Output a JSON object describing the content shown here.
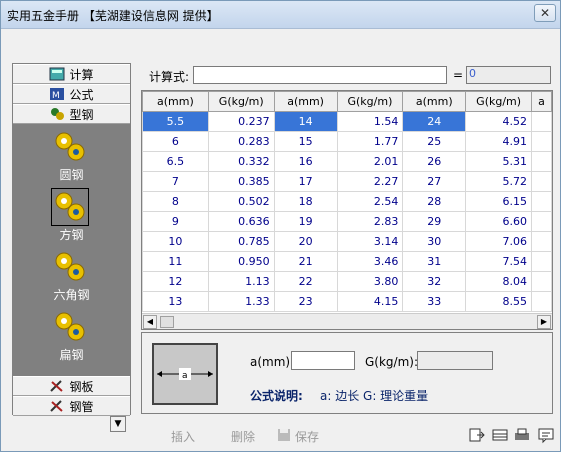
{
  "window": {
    "title": "实用五金手册 【芜湖建设信息网 提供】",
    "close_label": "✕"
  },
  "nav": {
    "categories": [
      {
        "label": "计算",
        "icon": "calculator-icon"
      },
      {
        "label": "公式",
        "icon": "formula-icon"
      },
      {
        "label": "型钢",
        "icon": "gears-icon"
      },
      {
        "label": "钢板",
        "icon": "tools-icon"
      },
      {
        "label": "钢管",
        "icon": "tools-icon"
      }
    ],
    "shapes": [
      {
        "label": "圆钢"
      },
      {
        "label": "方钢"
      },
      {
        "label": "六角钢"
      },
      {
        "label": "扁钢"
      }
    ]
  },
  "formula": {
    "label": "计算式:",
    "value": "",
    "equals": "=",
    "result": "0"
  },
  "table": {
    "headers": [
      "a(mm)",
      "G(kg/m)",
      "a(mm)",
      "G(kg/m)",
      "a(mm)",
      "G(kg/m)",
      "a"
    ],
    "rows": [
      [
        "5.5",
        "0.237",
        "14",
        "1.54",
        "24",
        "4.52"
      ],
      [
        "6",
        "0.283",
        "15",
        "1.77",
        "25",
        "4.91"
      ],
      [
        "6.5",
        "0.332",
        "16",
        "2.01",
        "26",
        "5.31"
      ],
      [
        "7",
        "0.385",
        "17",
        "2.27",
        "27",
        "5.72"
      ],
      [
        "8",
        "0.502",
        "18",
        "2.54",
        "28",
        "6.15"
      ],
      [
        "9",
        "0.636",
        "19",
        "2.83",
        "29",
        "6.60"
      ],
      [
        "10",
        "0.785",
        "20",
        "3.14",
        "30",
        "7.06"
      ],
      [
        "11",
        "0.950",
        "21",
        "3.46",
        "31",
        "7.54"
      ],
      [
        "12",
        "1.13",
        "22",
        "3.80",
        "32",
        "8.04"
      ],
      [
        "13",
        "1.33",
        "23",
        "4.15",
        "33",
        "8.55"
      ]
    ]
  },
  "bottom": {
    "diagram_label": "a",
    "a_label": "a(mm):",
    "a_value": "",
    "g_label": "G(kg/m):",
    "g_value": "",
    "note_title": "公式说明:",
    "note_text": "a: 边长   G: 理论重量"
  },
  "toolbar": {
    "insert": "插入",
    "delete": "删除",
    "save": "保存"
  },
  "colors": {
    "selected": "#3875d7",
    "value_text": "#00008b",
    "panel": "#808080"
  }
}
